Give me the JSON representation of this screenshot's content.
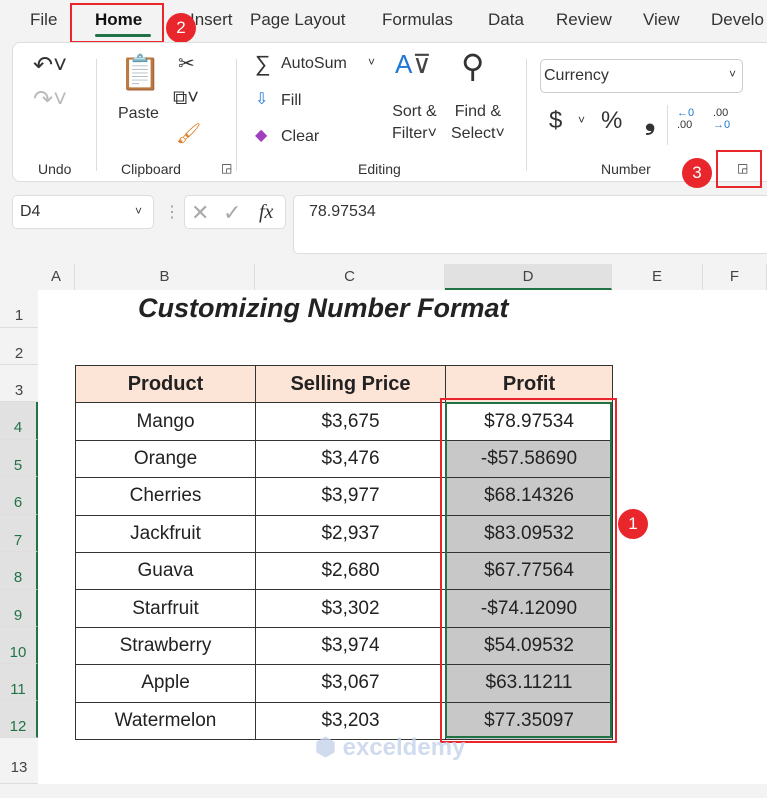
{
  "menu_tabs": [
    "File",
    "Home",
    "Insert",
    "Page Layout",
    "Formulas",
    "Data",
    "Review",
    "View",
    "Develo"
  ],
  "active_tab": "Home",
  "ribbon": {
    "undo_group": "Undo",
    "clipboard": {
      "paste": "Paste",
      "label": "Clipboard"
    },
    "editing": {
      "autosum": "AutoSum",
      "fill": "Fill",
      "clear": "Clear",
      "sort1": "Sort &",
      "sort2": "Filter",
      "find1": "Find &",
      "find2": "Select",
      "label": "Editing"
    },
    "number": {
      "format": "Currency",
      "dollar": "$",
      "percent": "%",
      "comma": "❟",
      "label": "Number"
    }
  },
  "formula_bar": {
    "name_box": "D4",
    "fx": "fx",
    "value": "78.97534"
  },
  "columns": [
    "A",
    "B",
    "C",
    "D",
    "E",
    "F"
  ],
  "rows": [
    "1",
    "2",
    "3",
    "4",
    "5",
    "6",
    "7",
    "8",
    "9",
    "10",
    "11",
    "12",
    "13"
  ],
  "sheet": {
    "title": "Customizing Number Format",
    "headers": [
      "Product",
      "Selling Price",
      "Profit"
    ],
    "data": [
      [
        "Mango",
        "$3,675",
        "$78.97534"
      ],
      [
        "Orange",
        "$3,476",
        "-$57.58690"
      ],
      [
        "Cherries",
        "$3,977",
        "$68.14326"
      ],
      [
        "Jackfruit",
        "$2,937",
        "$83.09532"
      ],
      [
        "Guava",
        "$2,680",
        "$67.77564"
      ],
      [
        "Starfruit",
        "$3,302",
        "-$74.12090"
      ],
      [
        "Strawberry",
        "$3,974",
        "$54.09532"
      ],
      [
        "Apple",
        "$3,067",
        "$63.11211"
      ],
      [
        "Watermelon",
        "$3,203",
        "$77.35097"
      ]
    ]
  },
  "badges": [
    "1",
    "2",
    "3"
  ],
  "watermark": "exceldemy",
  "colors": {
    "accent": "#217346",
    "highlight": "#e8262b",
    "header_fill": "#fce4d6",
    "selection": "#c8c8c8"
  }
}
